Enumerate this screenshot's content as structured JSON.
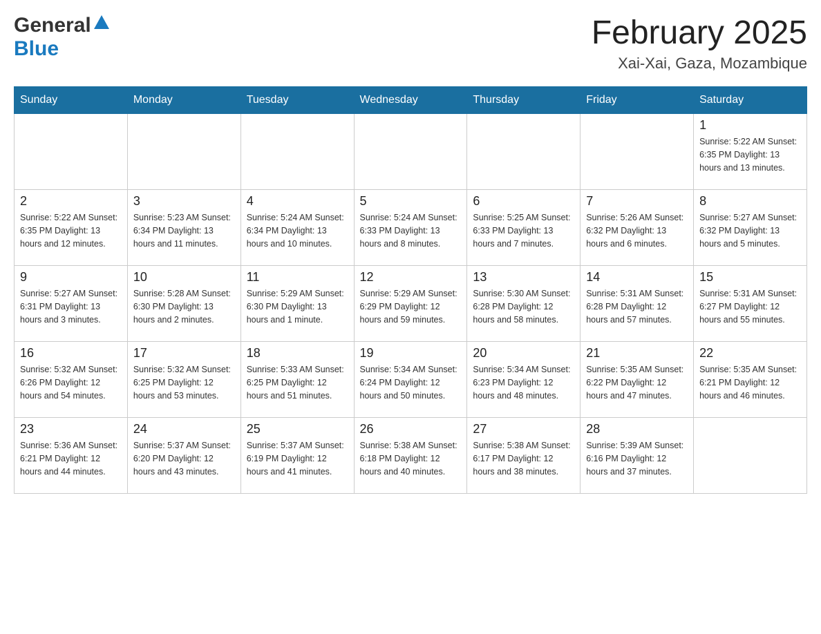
{
  "header": {
    "logo": {
      "general": "General",
      "blue": "Blue",
      "triangle_color": "#1a7abf"
    },
    "title": "February 2025",
    "location": "Xai-Xai, Gaza, Mozambique"
  },
  "calendar": {
    "days_of_week": [
      "Sunday",
      "Monday",
      "Tuesday",
      "Wednesday",
      "Thursday",
      "Friday",
      "Saturday"
    ],
    "weeks": [
      [
        {
          "day": "",
          "info": ""
        },
        {
          "day": "",
          "info": ""
        },
        {
          "day": "",
          "info": ""
        },
        {
          "day": "",
          "info": ""
        },
        {
          "day": "",
          "info": ""
        },
        {
          "day": "",
          "info": ""
        },
        {
          "day": "1",
          "info": "Sunrise: 5:22 AM\nSunset: 6:35 PM\nDaylight: 13 hours and 13 minutes."
        }
      ],
      [
        {
          "day": "2",
          "info": "Sunrise: 5:22 AM\nSunset: 6:35 PM\nDaylight: 13 hours and 12 minutes."
        },
        {
          "day": "3",
          "info": "Sunrise: 5:23 AM\nSunset: 6:34 PM\nDaylight: 13 hours and 11 minutes."
        },
        {
          "day": "4",
          "info": "Sunrise: 5:24 AM\nSunset: 6:34 PM\nDaylight: 13 hours and 10 minutes."
        },
        {
          "day": "5",
          "info": "Sunrise: 5:24 AM\nSunset: 6:33 PM\nDaylight: 13 hours and 8 minutes."
        },
        {
          "day": "6",
          "info": "Sunrise: 5:25 AM\nSunset: 6:33 PM\nDaylight: 13 hours and 7 minutes."
        },
        {
          "day": "7",
          "info": "Sunrise: 5:26 AM\nSunset: 6:32 PM\nDaylight: 13 hours and 6 minutes."
        },
        {
          "day": "8",
          "info": "Sunrise: 5:27 AM\nSunset: 6:32 PM\nDaylight: 13 hours and 5 minutes."
        }
      ],
      [
        {
          "day": "9",
          "info": "Sunrise: 5:27 AM\nSunset: 6:31 PM\nDaylight: 13 hours and 3 minutes."
        },
        {
          "day": "10",
          "info": "Sunrise: 5:28 AM\nSunset: 6:30 PM\nDaylight: 13 hours and 2 minutes."
        },
        {
          "day": "11",
          "info": "Sunrise: 5:29 AM\nSunset: 6:30 PM\nDaylight: 13 hours and 1 minute."
        },
        {
          "day": "12",
          "info": "Sunrise: 5:29 AM\nSunset: 6:29 PM\nDaylight: 12 hours and 59 minutes."
        },
        {
          "day": "13",
          "info": "Sunrise: 5:30 AM\nSunset: 6:28 PM\nDaylight: 12 hours and 58 minutes."
        },
        {
          "day": "14",
          "info": "Sunrise: 5:31 AM\nSunset: 6:28 PM\nDaylight: 12 hours and 57 minutes."
        },
        {
          "day": "15",
          "info": "Sunrise: 5:31 AM\nSunset: 6:27 PM\nDaylight: 12 hours and 55 minutes."
        }
      ],
      [
        {
          "day": "16",
          "info": "Sunrise: 5:32 AM\nSunset: 6:26 PM\nDaylight: 12 hours and 54 minutes."
        },
        {
          "day": "17",
          "info": "Sunrise: 5:32 AM\nSunset: 6:25 PM\nDaylight: 12 hours and 53 minutes."
        },
        {
          "day": "18",
          "info": "Sunrise: 5:33 AM\nSunset: 6:25 PM\nDaylight: 12 hours and 51 minutes."
        },
        {
          "day": "19",
          "info": "Sunrise: 5:34 AM\nSunset: 6:24 PM\nDaylight: 12 hours and 50 minutes."
        },
        {
          "day": "20",
          "info": "Sunrise: 5:34 AM\nSunset: 6:23 PM\nDaylight: 12 hours and 48 minutes."
        },
        {
          "day": "21",
          "info": "Sunrise: 5:35 AM\nSunset: 6:22 PM\nDaylight: 12 hours and 47 minutes."
        },
        {
          "day": "22",
          "info": "Sunrise: 5:35 AM\nSunset: 6:21 PM\nDaylight: 12 hours and 46 minutes."
        }
      ],
      [
        {
          "day": "23",
          "info": "Sunrise: 5:36 AM\nSunset: 6:21 PM\nDaylight: 12 hours and 44 minutes."
        },
        {
          "day": "24",
          "info": "Sunrise: 5:37 AM\nSunset: 6:20 PM\nDaylight: 12 hours and 43 minutes."
        },
        {
          "day": "25",
          "info": "Sunrise: 5:37 AM\nSunset: 6:19 PM\nDaylight: 12 hours and 41 minutes."
        },
        {
          "day": "26",
          "info": "Sunrise: 5:38 AM\nSunset: 6:18 PM\nDaylight: 12 hours and 40 minutes."
        },
        {
          "day": "27",
          "info": "Sunrise: 5:38 AM\nSunset: 6:17 PM\nDaylight: 12 hours and 38 minutes."
        },
        {
          "day": "28",
          "info": "Sunrise: 5:39 AM\nSunset: 6:16 PM\nDaylight: 12 hours and 37 minutes."
        },
        {
          "day": "",
          "info": ""
        }
      ]
    ]
  }
}
